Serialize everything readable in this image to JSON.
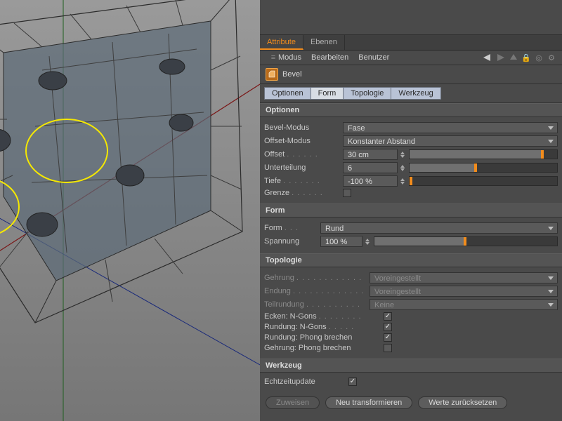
{
  "tabs": {
    "attribute": "Attribute",
    "layers": "Ebenen"
  },
  "menu": {
    "mode": "Modus",
    "edit": "Bearbeiten",
    "user": "Benutzer"
  },
  "object": {
    "name": "Bevel"
  },
  "subtabs": {
    "options": "Optionen",
    "form": "Form",
    "topology": "Topologie",
    "tool": "Werkzeug"
  },
  "sections": {
    "options": {
      "title": "Optionen",
      "bevel_mode": {
        "label": "Bevel-Modus",
        "value": "Fase"
      },
      "offset_mode": {
        "label": "Offset-Modus",
        "value": "Konstanter Abstand"
      },
      "offset": {
        "label": "Offset",
        "value": "30 cm",
        "fill": 90,
        "mark": 90
      },
      "subdivision": {
        "label": "Unterteilung",
        "value": "6",
        "fill": 45,
        "mark": 45
      },
      "depth": {
        "label": "Tiefe",
        "value": "-100 %",
        "fill": 0,
        "mark": 0
      },
      "limit": {
        "label": "Grenze",
        "checked": false
      }
    },
    "form": {
      "title": "Form",
      "shape": {
        "label": "Form",
        "value": "Rund"
      },
      "tension": {
        "label": "Spannung",
        "value": "100 %",
        "fill": 50,
        "mark": 50
      }
    },
    "topology": {
      "title": "Topologie",
      "miter": {
        "label": "Gehrung",
        "value": "Voreingestellt"
      },
      "ending": {
        "label": "Endung",
        "value": "Voreingestellt"
      },
      "partial": {
        "label": "Teilrundung",
        "value": "Keine"
      },
      "corners_ngons": {
        "label": "Ecken: N-Gons",
        "checked": true
      },
      "round_ngons": {
        "label": "Rundung: N-Gons",
        "checked": true
      },
      "round_phong": {
        "label": "Rundung: Phong brechen",
        "checked": true
      },
      "miter_phong": {
        "label": "Gehrung: Phong brechen",
        "checked": false
      }
    },
    "tool": {
      "title": "Werkzeug",
      "realtime": {
        "label": "Echtzeitupdate",
        "checked": true
      },
      "buttons": {
        "assign": "Zuweisen",
        "retransform": "Neu transformieren",
        "reset": "Werte zurücksetzen"
      }
    }
  }
}
